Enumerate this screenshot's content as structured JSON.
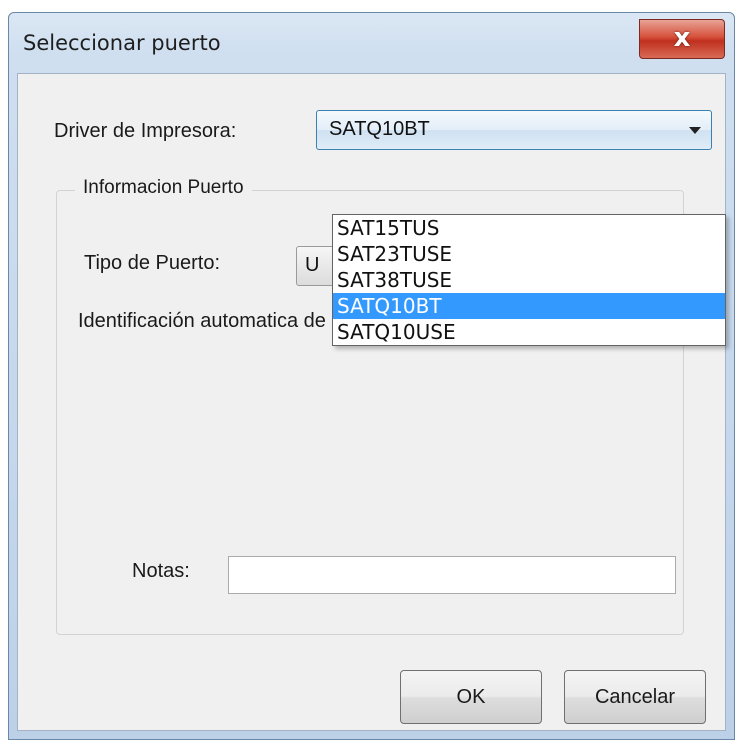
{
  "window": {
    "title": "Seleccionar puerto",
    "close_glyph": "x",
    "close_icon": "close-x-icon"
  },
  "driver": {
    "label": "Driver de Impresora:",
    "selected": "SATQ10BT",
    "options": [
      "SAT15TUS",
      "SAT23TUSE",
      "SAT38TUSE",
      "SATQ10BT",
      "SATQ10USE"
    ],
    "highlighted_index": 3,
    "highlight_color": "#3399ff"
  },
  "port_group": {
    "legend": "Informacion Puerto",
    "tipo_label": "Tipo  de Puerto:",
    "tipo_value": "U",
    "ident_text": "Identificación automatica de puerto.",
    "notas_label": "Notas:",
    "notas_value": ""
  },
  "buttons": {
    "ok": "OK",
    "cancel": "Cancelar"
  }
}
